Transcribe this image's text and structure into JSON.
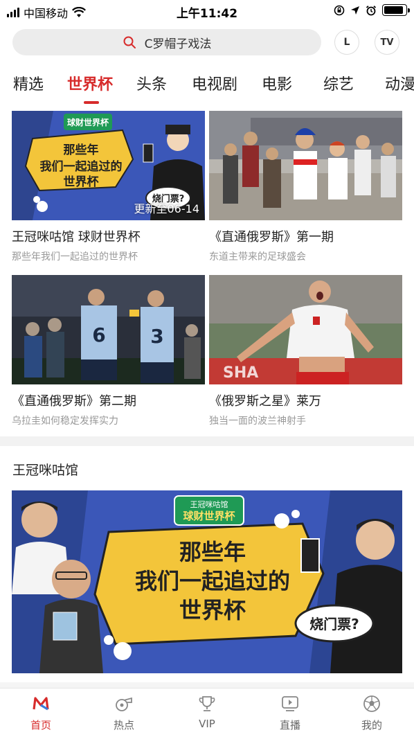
{
  "status_bar": {
    "carrier": "中国移动",
    "time": "上午11:42",
    "battery_level": 0.9
  },
  "search": {
    "text": "C罗帽子戏法",
    "icon": "search-icon"
  },
  "header_buttons": {
    "left": "L",
    "right": "TV"
  },
  "tabs": [
    {
      "label": "精选"
    },
    {
      "label": "世界杯",
      "active": true
    },
    {
      "label": "头条"
    },
    {
      "label": "电视剧"
    },
    {
      "label": "电影"
    },
    {
      "label": "综艺"
    },
    {
      "label": "动漫"
    }
  ],
  "cards": [
    {
      "title": "王冠咪咕馆 球财世界杯",
      "subtitle": "那些年我们一起追过的世界杯",
      "badge": "更新至06-14",
      "thumb_text_1": "那些年",
      "thumb_text_2": "我们一起追过的",
      "thumb_text_3": "世界杯",
      "thumb_bubble": "烧门票?"
    },
    {
      "title": "《直通俄罗斯》第一期",
      "subtitle": "东道主带来的足球盛会"
    },
    {
      "title": "《直通俄罗斯》第二期",
      "subtitle": "乌拉圭如何稳定发挥实力"
    },
    {
      "title": "《俄罗斯之星》莱万",
      "subtitle": "独当一面的波兰神射手"
    }
  ],
  "section": {
    "title": "王冠咪咕馆",
    "banner": {
      "logo_top": "王冠咪咕馆",
      "logo_main": "球财世界杯",
      "line1": "那些年",
      "line2": "我们一起追过的",
      "line3": "世界杯",
      "bubble": "烧门票?"
    }
  },
  "bottom_nav": [
    {
      "label": "首页",
      "icon": "migu-logo-icon",
      "active": true
    },
    {
      "label": "热点",
      "icon": "whistle-icon"
    },
    {
      "label": "VIP",
      "icon": "trophy-icon"
    },
    {
      "label": "直播",
      "icon": "play-screen-icon"
    },
    {
      "label": "我的",
      "icon": "football-icon"
    }
  ],
  "colors": {
    "accent": "#d72b2b",
    "banner_blue": "#3b57b8",
    "banner_yellow": "#f3c53a"
  }
}
